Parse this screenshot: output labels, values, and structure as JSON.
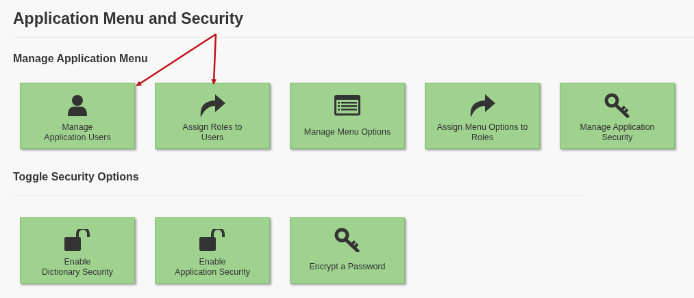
{
  "title": "Application Menu and Security",
  "sections": [
    {
      "heading": "Manage Application Menu",
      "tiles": [
        {
          "kind": "user",
          "label": "Manage\nApplication Users"
        },
        {
          "kind": "share",
          "label": "Assign Roles to\nUsers"
        },
        {
          "kind": "list",
          "label": "Manage Menu Options"
        },
        {
          "kind": "share",
          "label": "Assign Menu Options to\nRoles"
        },
        {
          "kind": "key",
          "label": "Manage Application\nSecurity"
        }
      ]
    },
    {
      "heading": "Toggle Security Options",
      "tiles": [
        {
          "kind": "unlock",
          "label": "Enable\nDictionary Security"
        },
        {
          "kind": "unlock",
          "label": "Enable\nApplication Security"
        },
        {
          "kind": "key",
          "label": "Encrypt a Password"
        }
      ]
    }
  ],
  "annotations": [
    {
      "kind": "arrow"
    },
    {
      "kind": "arrow"
    }
  ]
}
